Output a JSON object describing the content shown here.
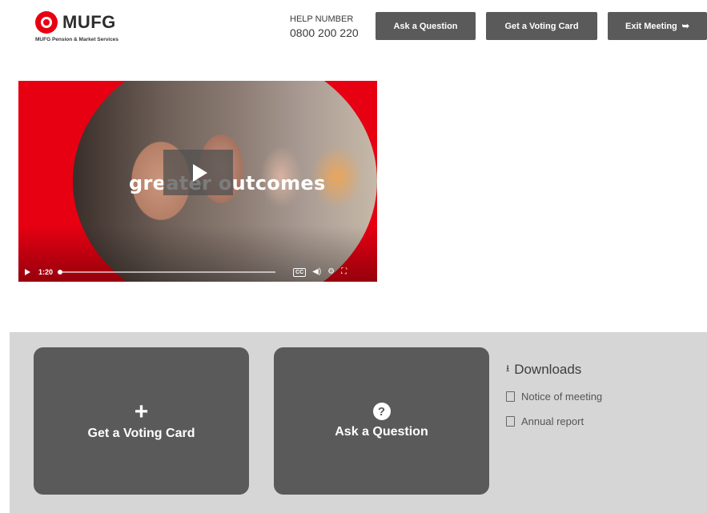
{
  "header": {
    "logo_text": "MUFG",
    "logo_subtitle": "MUFG Pension & Market Services",
    "help_label": "HELP NUMBER",
    "help_number": "0800 200 220",
    "ask_question_label": "Ask a Question",
    "voting_card_label": "Get a Voting Card",
    "exit_meeting_label": "Exit Meeting"
  },
  "video": {
    "caption": "greater outcomes",
    "time": "1:20",
    "progress": 0.01
  },
  "cards": {
    "voting_card_label": "Get a Voting Card",
    "ask_question_label": "Ask a Question"
  },
  "downloads": {
    "heading": "Downloads",
    "items": [
      {
        "label": "Notice of meeting"
      },
      {
        "label": "Annual report"
      }
    ]
  },
  "colors": {
    "brand_red": "#e60012",
    "button_gray": "#5a5a5a",
    "panel_gray": "#d6d6d6"
  }
}
